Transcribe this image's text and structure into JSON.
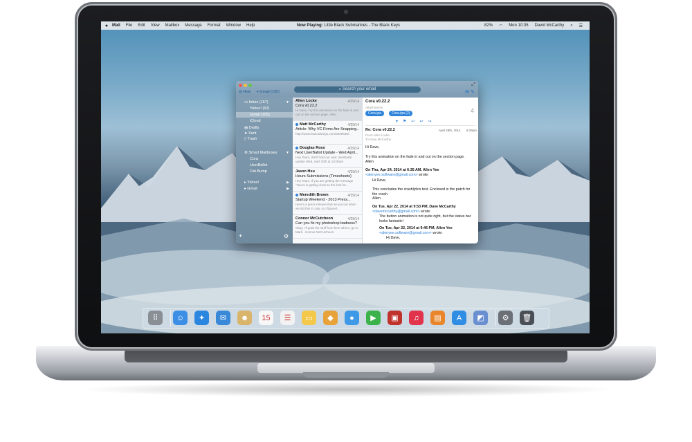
{
  "menubar": {
    "apple": "",
    "items": [
      "Mail",
      "File",
      "Edit",
      "View",
      "Mailbox",
      "Message",
      "Format",
      "Window",
      "Help"
    ],
    "now_playing_label": "Now Playing:",
    "now_playing_value": "Little Black Submarines - The Black Keys",
    "battery": "82%",
    "clock": "Mon 10:35",
    "user": "David McCarthy"
  },
  "mail": {
    "hide_label": "Hide",
    "account_label": "Gmail (105)",
    "search_placeholder": "Search your email",
    "sidebar": {
      "inbox": "Inbox (157)",
      "yahoo": "Yahoo! (52)",
      "gmail": "Gmail (105)",
      "icloud": "iCloud",
      "drafts": "Drafts",
      "sent": "Sent",
      "trash": "Trash",
      "smart": "Smart Mailboxes",
      "cora": "Cora",
      "userballot": "UserBallot",
      "fistbump": "Fist Bump",
      "yahoo_acct": "Yahoo!",
      "gmail_acct": "Gmail",
      "add": "+",
      "settings": "⚙"
    },
    "messages": [
      {
        "from": "Allen Locke",
        "date": "4/29/14",
        "subject": "Cora v0.22.2",
        "preview": "Hi Dave, Try this animation on the fade in and out on the section page. Allen"
      },
      {
        "from": "Matt McCarthy",
        "date": "4/29/14",
        "subject": "Article: Why VC Firms Are Snapping...",
        "preview": "http://www.fastcodesign.com/3029638/..."
      },
      {
        "from": "Douglas Ross",
        "date": "4/29/14",
        "subject": "Next UserBallot Update - Wed April...",
        "preview": "Hey Team, We'll hold our next UserBallot update Wed, April 30th at 10:00am"
      },
      {
        "from": "Jason Hsu",
        "date": "4/29/14",
        "subject": "Hours Submissions (Timesheets)",
        "preview": "Hey Team, If you are getting the message \"Hours is getting close to the limit for..."
      },
      {
        "from": "Meredith Brown",
        "date": "4/29/14",
        "subject": "Startup Weekend - 2013 Press...",
        "preview": "Here's a press release that we put out when we did this in July, so I figured..."
      },
      {
        "from": "Connor McCutcheon",
        "date": "4/29/14",
        "subject": "Can you fix my photoshop badness?",
        "preview": "Okay, I'll grab the stuff from here when I go to Mark. -Connor McCutcheon"
      }
    ],
    "reader": {
      "subject": "Cora v0.22.2",
      "attachments_label": "Attachments",
      "chip1": "Cora.ipa",
      "chip2": "Cora.ipa (2)",
      "count": "4",
      "reply_subject": "Re: Cora v0.22.2",
      "reply_date": "April 29th, 2014",
      "reply_time": "8:29pm",
      "from_line": "From Allen Locke",
      "to_line": "To Dave McCarthy",
      "greeting": "Hi Dave,",
      "body1": "Try this animation on the fade in and out on the section page.",
      "sig": "Allen",
      "q1_head": "On Thu, Apr 24, 2014 at 6:35 AM, Allen Yee",
      "q1_email": "<alenyee.software@gmail.com>",
      "q1_wrote": "wrote:",
      "q1_hi": "Hi Dave,",
      "q1_body": "This concludes the crashlytics test.  Enclosed is the patch for the crash.",
      "q1_sig": "Allen",
      "q2_head": "On Tue, Apr 22, 2014 at 9:53 PM, Dave McCarthy",
      "q2_email": "<davemccarthy@gmail.com>",
      "q2_body": "The button animation is not quite right, but the status bar looks fantastic!",
      "q3_head": "On Tue, Apr 22, 2014 at 9:46 PM, Allen Yee",
      "q3_email": "<alenyee.software@gmail.com>",
      "q3_hi": "Hi Dave,"
    }
  },
  "dock": [
    {
      "name": "launchpad-icon",
      "glyph": "⠿",
      "color": "#8a8f96"
    },
    {
      "name": "finder-icon",
      "glyph": "☺",
      "color": "#3d8fe6"
    },
    {
      "name": "safari-icon",
      "glyph": "✦",
      "color": "#2b86e0"
    },
    {
      "name": "mail-stamp-icon",
      "glyph": "✉",
      "color": "#3a88d8"
    },
    {
      "name": "contacts-icon",
      "glyph": "☻",
      "color": "#d8b56a"
    },
    {
      "name": "calendar-icon",
      "glyph": "15",
      "color": "#f7f7f7"
    },
    {
      "name": "reminders-icon",
      "glyph": "☰",
      "color": "#f2f2f2"
    },
    {
      "name": "notes-icon",
      "glyph": "▭",
      "color": "#f4c84a"
    },
    {
      "name": "maps-icon",
      "glyph": "◆",
      "color": "#e8a23a"
    },
    {
      "name": "messages-icon",
      "glyph": "●",
      "color": "#3e9ae6"
    },
    {
      "name": "facetime-icon",
      "glyph": "▶",
      "color": "#3bb34a"
    },
    {
      "name": "photo-booth-icon",
      "glyph": "▣",
      "color": "#c0322c"
    },
    {
      "name": "itunes-icon",
      "glyph": "♫",
      "color": "#e2334c"
    },
    {
      "name": "ibooks-icon",
      "glyph": "▤",
      "color": "#e9862b"
    },
    {
      "name": "app-store-icon",
      "glyph": "A",
      "color": "#2f8de4"
    },
    {
      "name": "preview-icon",
      "glyph": "◩",
      "color": "#6a8fd0"
    },
    {
      "name": "system-preferences-icon",
      "glyph": "⚙",
      "color": "#6b7077"
    },
    {
      "name": "trash-icon",
      "glyph": "🗑",
      "color": "#4a4f56"
    }
  ]
}
